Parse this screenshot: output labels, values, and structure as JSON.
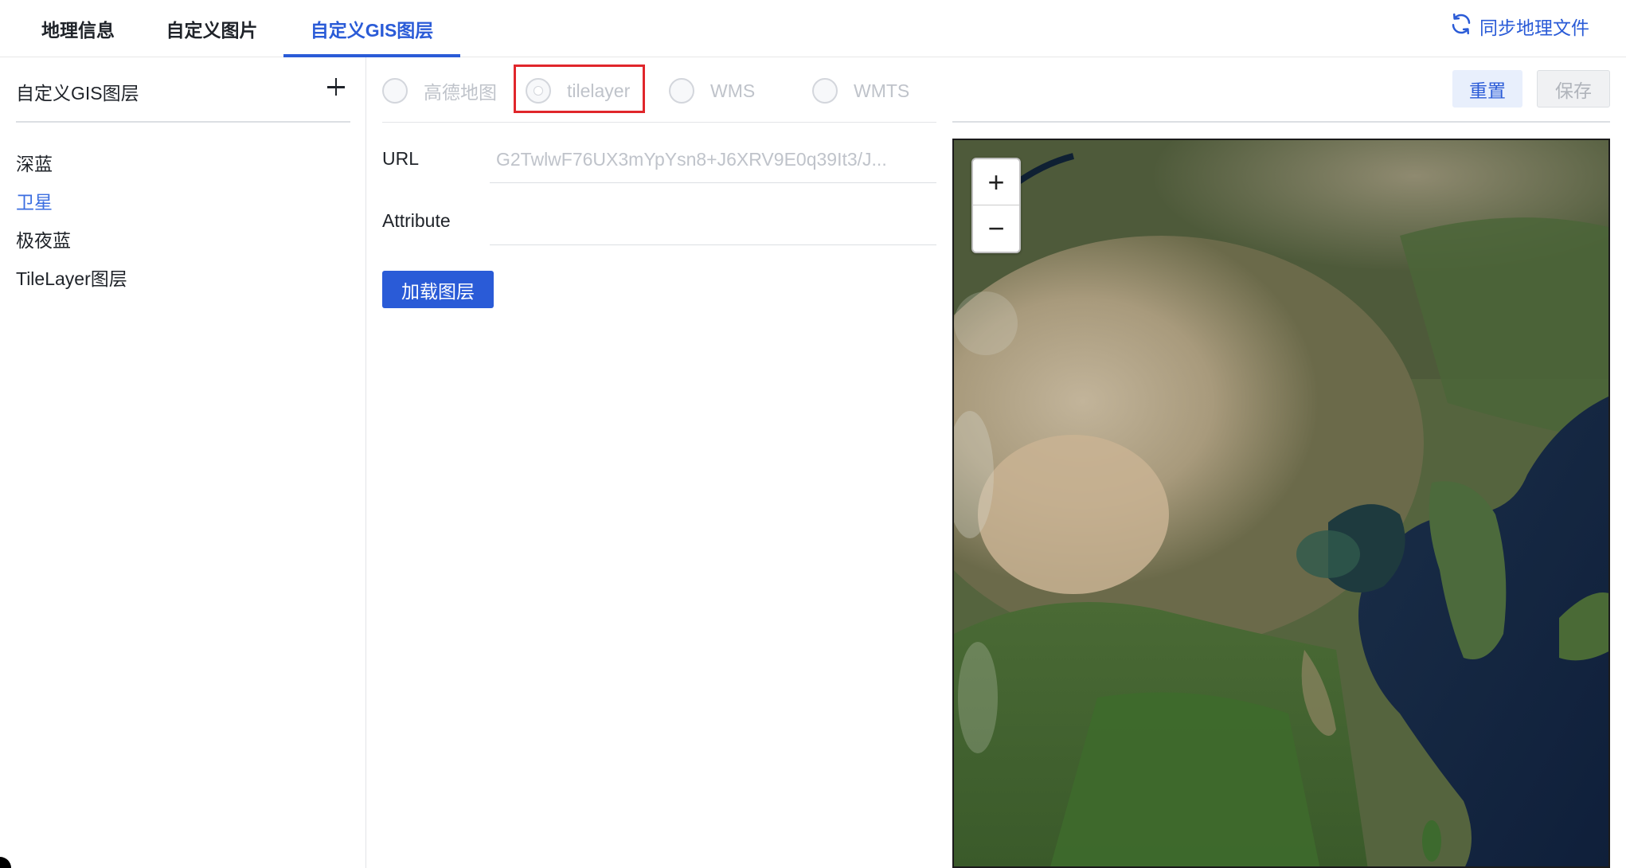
{
  "tabs": [
    {
      "label": "地理信息"
    },
    {
      "label": "自定义图片"
    },
    {
      "label": "自定义GIS图层"
    }
  ],
  "active_tab": "自定义GIS图层",
  "sync": {
    "label": "同步地理文件",
    "icon": "refresh-icon"
  },
  "sidebar": {
    "title": "自定义GIS图层",
    "add_icon": "plus-icon",
    "items": [
      {
        "label": "深蓝"
      },
      {
        "label": "卫星"
      },
      {
        "label": "极夜蓝"
      },
      {
        "label": "TileLayer图层"
      }
    ],
    "selected": "卫星"
  },
  "layer_type": {
    "options": [
      {
        "label": "高德地图"
      },
      {
        "label": "tilelayer"
      },
      {
        "label": "WMS"
      },
      {
        "label": "WMTS"
      }
    ],
    "selected": "tilelayer"
  },
  "form": {
    "url_label": "URL",
    "url_value": "G2TwlwF76UX3mYpYsn8+J6XRV9E0q39It3/J...",
    "attribute_label": "Attribute",
    "attribute_value": "",
    "load_button": "加载图层"
  },
  "actions": {
    "reset": "重置",
    "save": "保存"
  },
  "map": {
    "zoom_in": "+",
    "zoom_out": "−"
  },
  "colors": {
    "accent": "#2a5bd7",
    "highlight": "#e0262b",
    "selected_item": "#3b6ee0"
  }
}
